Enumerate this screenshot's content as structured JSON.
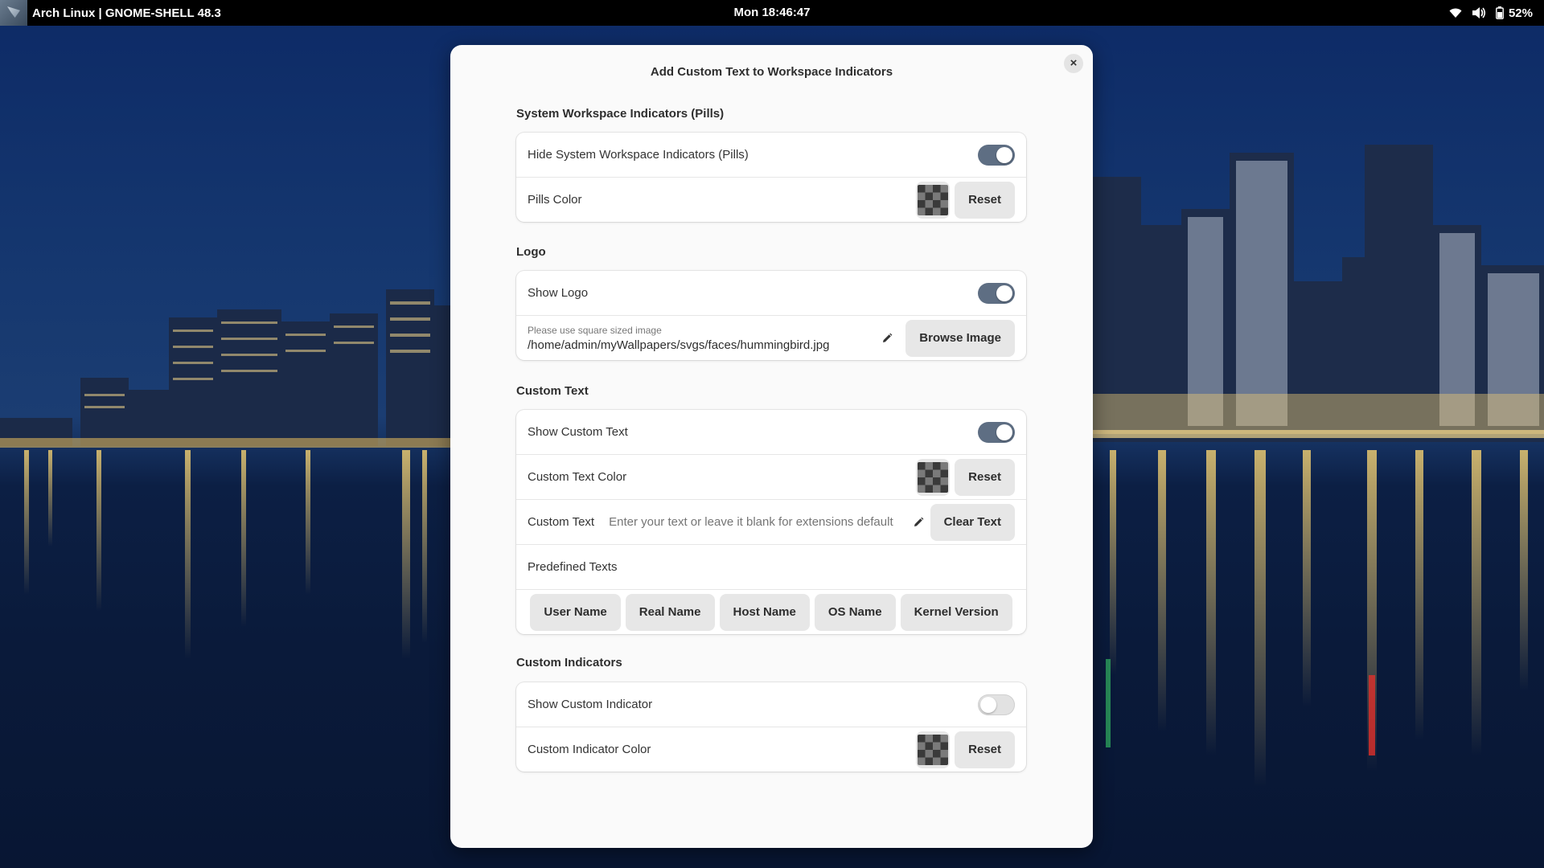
{
  "topbar": {
    "app_name": "Arch Linux | GNOME-SHELL 48.3",
    "clock": "Mon 18:46:47",
    "battery": "52%",
    "icons": [
      "wifi-icon",
      "volume-icon",
      "battery-icon"
    ]
  },
  "dialog": {
    "title": "Add Custom Text to Workspace Indicators",
    "close_label": "×",
    "sections": {
      "pills": {
        "title": "System Workspace Indicators (Pills)",
        "hide_label": "Hide System Workspace Indicators (Pills)",
        "hide_on": true,
        "color_label": "Pills Color",
        "reset_label": "Reset"
      },
      "logo": {
        "title": "Logo",
        "show_label": "Show Logo",
        "show_on": true,
        "path_hint": "Please use square sized image",
        "path_value": "/home/admin/myWallpapers/svgs/faces/hummingbird.jpg",
        "browse_label": "Browse Image"
      },
      "custom_text": {
        "title": "Custom Text",
        "show_label": "Show Custom Text",
        "show_on": true,
        "color_label": "Custom Text Color",
        "reset_label": "Reset",
        "text_label": "Custom Text",
        "text_placeholder": "Enter your text or leave it blank for extensions default",
        "clear_label": "Clear Text",
        "predefined_label": "Predefined Texts",
        "predefined": [
          "User Name",
          "Real Name",
          "Host Name",
          "OS Name",
          "Kernel Version"
        ]
      },
      "custom_indicators": {
        "title": "Custom Indicators",
        "show_label": "Show Custom Indicator",
        "show_on": false,
        "color_label": "Custom Indicator Color",
        "reset_label": "Reset"
      }
    }
  },
  "colors": {
    "toggle_on": "#5e6e83",
    "dialog_bg": "#fafafa",
    "topbar_bg": "#000000"
  }
}
